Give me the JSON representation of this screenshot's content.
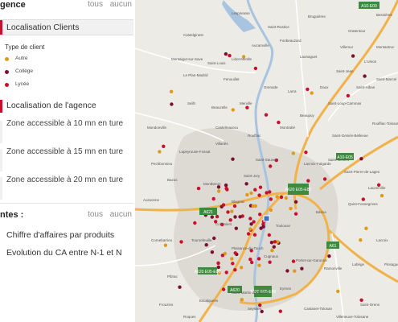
{
  "panel": {
    "agence_section": {
      "title": "gence",
      "links": [
        "tous",
        "aucun"
      ]
    },
    "localisation_clients": "Localisation Clients",
    "type_client_title": "Type de client",
    "client_types": [
      {
        "label": "Autre",
        "color": "#e09a1a"
      },
      {
        "label": "Collège",
        "color": "#7a1030"
      },
      {
        "label": "Lycée",
        "color": "#c8102e"
      }
    ],
    "localisation_agence": "Localisation de l'agence",
    "zones": [
      "Zone accessible à 10 mn en ture",
      "Zone accessible à 15 mn en ture",
      "Zone accessible à 20 mn en ture"
    ],
    "stats_section": {
      "title": "ntes :",
      "links": [
        "tous",
        "aucun"
      ]
    },
    "stats_items": [
      "Chiffre d'affaires par produits",
      "Evolution du CA entre N-1 et N"
    ]
  },
  "map": {
    "places": [
      "Lespinasse",
      "Bruguières",
      "Gratentour",
      "Fonbeauzard",
      "Launaguet",
      "L'Union",
      "Saint-Jean",
      "Castelginest",
      "Aucamville",
      "Fenouillet",
      "Saint-Alban",
      "Saint-Loup-Cammas",
      "Beaupuy",
      "Montrabé",
      "Rouffiac-Tolosan",
      "Saint-Geniès-Bellevue",
      "Pechbonnieu",
      "Lapeyrouse-Fossat",
      "Villariès",
      "Saint-Sauveur",
      "Bazus",
      "Montberon",
      "Saint-Jory",
      "Lacroix-Falgarde",
      "Saint-Pierre-de-Lages",
      "Lauzerville",
      "Quint-Fonsegrives",
      "Balma",
      "Toulouse",
      "Blagnac",
      "Colomiers",
      "Tournefeuille",
      "Plaisance-du-Touch",
      "Cugnaux",
      "Portet-sur-Garonne",
      "Ramonville",
      "Labège",
      "Castanet-Tolosan",
      "Saint-Orens",
      "Escalquens",
      "Pibrac",
      "Cornebarrieu",
      "Aussonne",
      "Mondonville",
      "Seilh",
      "Beauzelle",
      "Merville",
      "Grenade",
      "Larra",
      "Daux",
      "Montaigut-sur-Save",
      "Le Plan-Madrid",
      "Saint-Louis",
      "Lidot-Merdle",
      "Saint-Rustice",
      "Villemur",
      "Bessières",
      "Montastruc",
      "Saint-Marcel",
      "Saint-Geniès",
      "Castelmaurou",
      "Rouffiac",
      "Saint-Martin-du-Touch",
      "Eyrnes",
      "Seysses",
      "Frouzins",
      "Roques",
      "Villeneuve-Tolosane",
      "Lacroix",
      "Pinsaguel",
      "Vigoulet",
      "Vieille-Toulouse",
      "Ramonville-Saint-Agne",
      "Auzeville",
      "Mervilla",
      "Pechabou",
      "Pompertuzat",
      "Deyme",
      "Donneville",
      "Montlaur"
    ],
    "road_shields": [
      "A10-E09",
      "A10-E05",
      "A620 E05-E80",
      "A621",
      "A620 E05-E80",
      "A620",
      "A620 E05-E80",
      "A61"
    ],
    "zoom_label": ""
  }
}
